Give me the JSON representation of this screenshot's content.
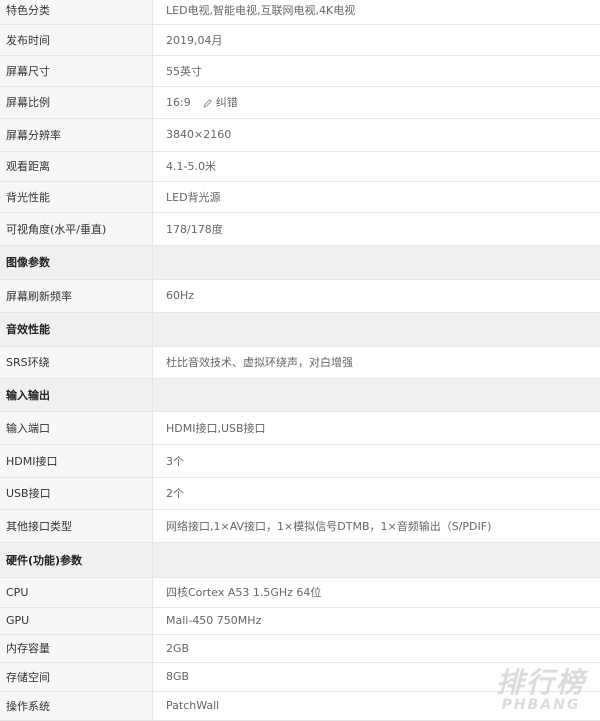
{
  "rows": [
    {
      "k": "特色分类",
      "v": "LED电视,智能电视,互联网电视,4K电视"
    },
    {
      "k": "发布时间",
      "v": "2019,04月"
    },
    {
      "k": "屏幕尺寸",
      "v": "55英寸"
    },
    {
      "k": "屏幕比例",
      "v": "16:9",
      "extra": "纠错"
    },
    {
      "k": "屏幕分辨率",
      "v": "3840×2160"
    },
    {
      "k": "观看距离",
      "v": "4.1-5.0米"
    },
    {
      "k": "背光性能",
      "v": "LED背光源"
    },
    {
      "k": "可视角度(水平/垂直)",
      "v": "178/178度"
    },
    {
      "section": "图像参数"
    },
    {
      "k": "屏幕刷新频率",
      "v": "60Hz"
    },
    {
      "section": "音效性能"
    },
    {
      "k": "SRS环绕",
      "v": "杜比音效技术、虚拟环绕声，对白增强"
    },
    {
      "section": "输入输出"
    },
    {
      "k": "输入端口",
      "v": "HDMI接口,USB接口"
    },
    {
      "k": "HDMI接口",
      "v": "3个"
    },
    {
      "k": "USB接口",
      "v": "2个"
    },
    {
      "k": "其他接口类型",
      "v": "网络接口,1×AV接口，1×模拟信号DTMB，1×音频输出（S/PDIF)"
    },
    {
      "section": "硬件(功能)参数"
    },
    {
      "k": "CPU",
      "v": "四核Cortex A53 1.5GHz 64位"
    },
    {
      "k": "GPU",
      "v": "Mali-450 750MHz"
    },
    {
      "k": "内存容量",
      "v": "2GB"
    },
    {
      "k": "存储空间",
      "v": "8GB"
    },
    {
      "k": "操作系统",
      "v": "PatchWall"
    }
  ],
  "watermark": {
    "cn": "排行榜",
    "en": "PHBANG"
  }
}
